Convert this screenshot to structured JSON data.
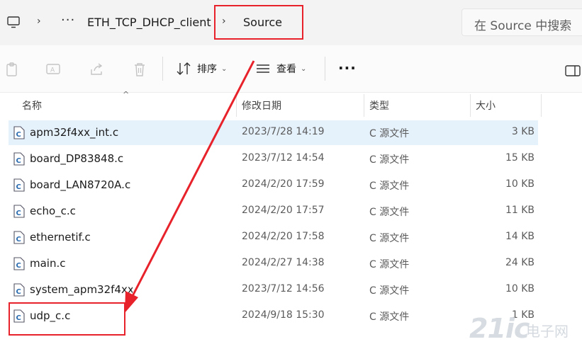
{
  "address_bar": {
    "crumbs": [
      "ETH_TCP_DHCP_client",
      "Source"
    ],
    "more": "···",
    "chevron": "›"
  },
  "search": {
    "placeholder": "在 Source 中搜索"
  },
  "toolbar": {
    "sort_label": "排序",
    "view_label": "查看",
    "more_label": "···"
  },
  "columns": {
    "name": "名称",
    "modified": "修改日期",
    "type": "类型",
    "size": "大小"
  },
  "files": [
    {
      "name": "apm32f4xx_int.c",
      "modified": "2023/7/28 14:19",
      "type": "C 源文件",
      "size": "3 KB",
      "selected": true
    },
    {
      "name": "board_DP83848.c",
      "modified": "2023/7/12 14:54",
      "type": "C 源文件",
      "size": "15 KB"
    },
    {
      "name": "board_LAN8720A.c",
      "modified": "2024/2/20 17:59",
      "type": "C 源文件",
      "size": "10 KB"
    },
    {
      "name": "echo_c.c",
      "modified": "2024/2/20 17:57",
      "type": "C 源文件",
      "size": "11 KB"
    },
    {
      "name": "ethernetif.c",
      "modified": "2024/2/20 17:58",
      "type": "C 源文件",
      "size": "14 KB"
    },
    {
      "name": "main.c",
      "modified": "2024/2/27 14:38",
      "type": "C 源文件",
      "size": "24 KB"
    },
    {
      "name": "system_apm32f4xx.c",
      "modified": "2023/7/12 14:56",
      "type": "C 源文件",
      "size": "10 KB"
    },
    {
      "name": "udp_c.c",
      "modified": "2024/9/18 15:30",
      "type": "C 源文件",
      "size": "1 KB"
    }
  ],
  "watermark": {
    "logo": "21ic",
    "text": "电子网"
  },
  "colors": {
    "highlight": "#e8222a",
    "selected_row": "#e5f1fb",
    "accent": "#0067c0"
  }
}
